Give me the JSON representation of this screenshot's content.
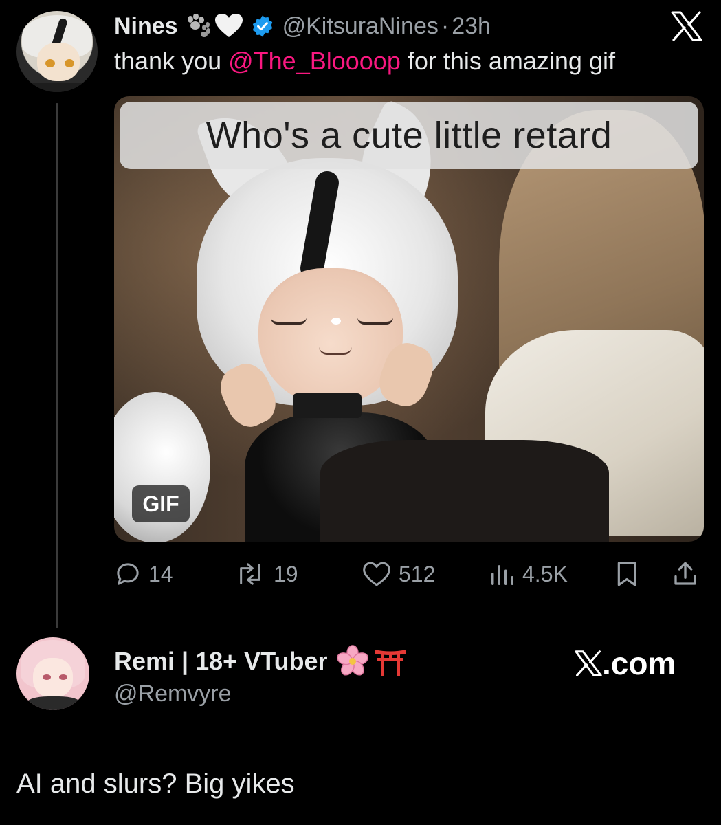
{
  "tweet": {
    "author_name": "Nines",
    "handle": "@KitsuraNines",
    "separator": "·",
    "time": "23h",
    "text_before": "thank you ",
    "mention": "@The_Bloooop",
    "text_after": " for this amazing gif",
    "media": {
      "caption": "Who's a cute little retard",
      "badge": "GIF"
    },
    "stats": {
      "replies": "14",
      "retweets": "19",
      "likes": "512",
      "views": "4.5K"
    },
    "icons": [
      "paw-icon",
      "white-heart-icon",
      "verified-badge-icon",
      "x-logo-icon",
      "reply-icon",
      "retweet-icon",
      "like-icon",
      "views-icon",
      "bookmark-icon",
      "share-icon"
    ]
  },
  "reply": {
    "author_name": "Remi | 18+ VTuber",
    "handle": "@Remvyre",
    "watermark": ".com",
    "text": "AI and slurs? Big yikes",
    "icons": [
      "cherry-blossom-icon",
      "torii-gate-icon",
      "x-logo-icon"
    ]
  },
  "colors": {
    "background": "#000000",
    "text": "#e7e9ea",
    "muted": "#9aa0a6",
    "mention": "#f91880",
    "verified": "#1d9bf0"
  }
}
